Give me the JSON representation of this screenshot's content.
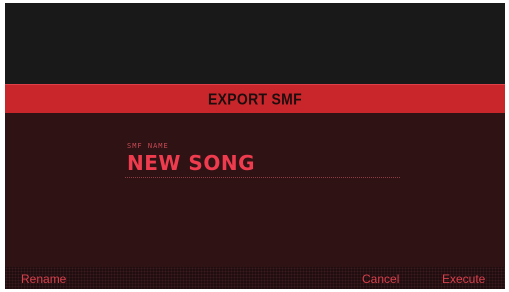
{
  "dialog": {
    "title": "EXPORT SMF"
  },
  "field": {
    "label": "SMF NAME",
    "value": "NEW SONG"
  },
  "footer": {
    "rename_label": "Rename",
    "cancel_label": "Cancel",
    "execute_label": "Execute"
  },
  "colors": {
    "accent": "#c8262a",
    "text_red": "#ee3c4e",
    "panel_bg": "#2e1214",
    "screen_bg": "#191919"
  }
}
